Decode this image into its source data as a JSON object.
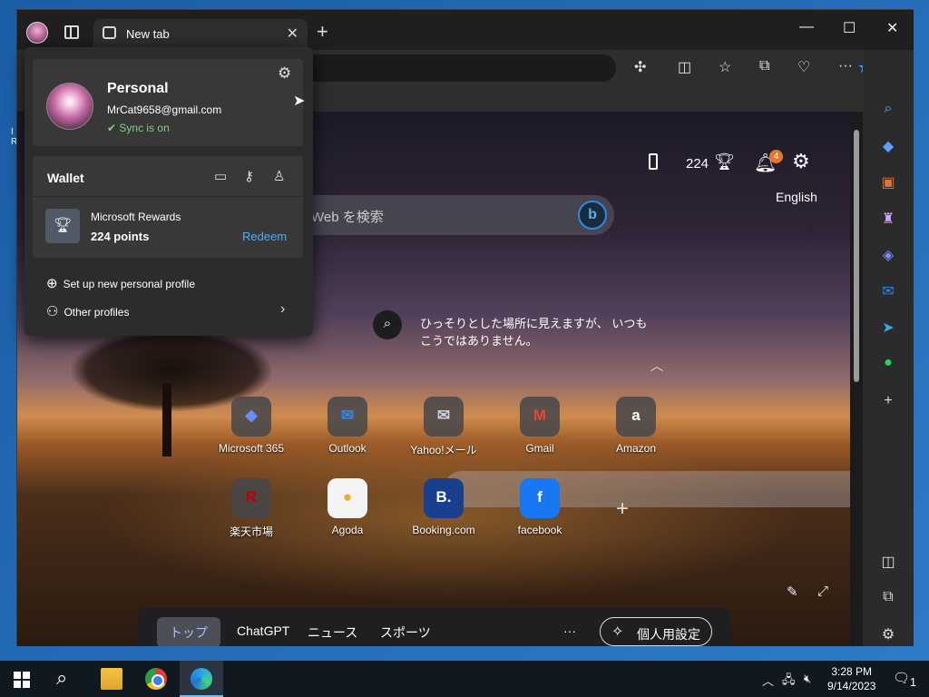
{
  "tab": {
    "title": "New tab",
    "close": "✕",
    "new": "+"
  },
  "window_controls": {
    "minimize": "—",
    "maximize": "☐",
    "close": "✕"
  },
  "toolbar": {
    "bing_glyph": "b"
  },
  "ntp": {
    "points": "224",
    "notification_count": "4",
    "language": "English",
    "search_placeholder": "Web を検索",
    "bing_glyph": "b",
    "caption": "ひっそりとした場所に見えますが、 いつもこうではありません。",
    "tiles": [
      {
        "label": "Microsoft 365",
        "glyph": "◆",
        "color": "#6a8dff"
      },
      {
        "label": "Outlook",
        "glyph": "✉",
        "color": "#2a8bea"
      },
      {
        "label": "Yahoo!メール",
        "glyph": "✉",
        "color": "#c9d1df"
      },
      {
        "label": "Gmail",
        "glyph": "M",
        "color": "#ea4335"
      },
      {
        "label": "Amazon",
        "glyph": "a",
        "color": "#ffffff"
      },
      {
        "label": "楽天市場",
        "glyph": "R",
        "color": "#bf0000"
      },
      {
        "label": "Agoda",
        "glyph": "●",
        "color": "#f2a83a"
      },
      {
        "label": "Booking.com",
        "glyph": "B.",
        "color": "#ffffff"
      },
      {
        "label": "facebook",
        "glyph": "f",
        "color": "#ffffff"
      }
    ],
    "bottom_nav": [
      "トップ",
      "ChatGPT",
      "ニュース",
      "スポーツ"
    ],
    "more": "···",
    "personalize": "個人用設定"
  },
  "profile": {
    "name": "Personal",
    "email": "MrCat9658@gmail.com",
    "sync_status": "Sync is on",
    "wallet_title": "Wallet",
    "rewards_name": "Microsoft Rewards",
    "rewards_points": "224 points",
    "redeem": "Redeem",
    "new_profile": "Set up new personal profile",
    "other_profiles": "Other profiles"
  },
  "taskbar": {
    "time": "3:28 PM",
    "date": "9/14/2023",
    "notification_count": "1"
  },
  "colors": {
    "accent": "#3a9af5",
    "sync_green": "#7fd27f",
    "redeem_blue": "#55aaf2",
    "badge_orange": "#e8762a"
  }
}
